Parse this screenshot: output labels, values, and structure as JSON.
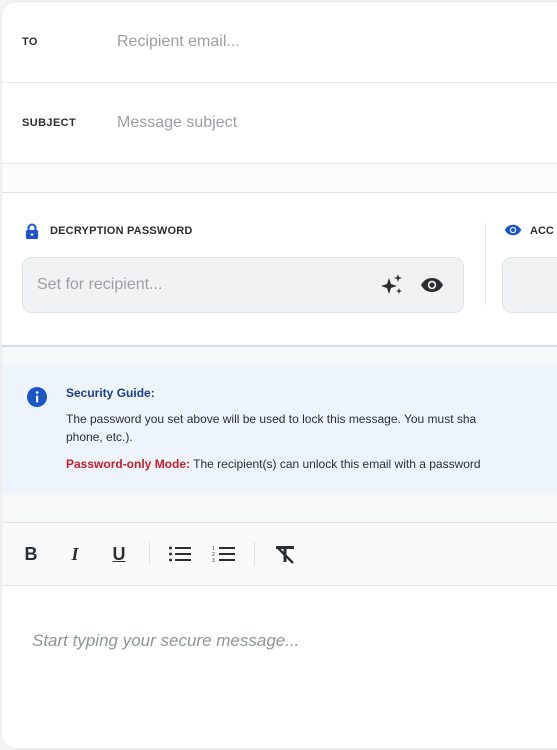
{
  "compose": {
    "to": {
      "label": "TO",
      "placeholder": "Recipient email..."
    },
    "subject": {
      "label": "SUBJECT",
      "placeholder": "Message subject"
    }
  },
  "password": {
    "title": "DECRYPTION PASSWORD",
    "placeholder": "Set for recipient...",
    "generate_icon": "sparkle-icon",
    "toggle_icon": "eye-icon"
  },
  "access": {
    "title_partial": "ACC"
  },
  "guide": {
    "title": "Security Guide:",
    "line1": "The password you set above will be used to lock this message. You must sha",
    "line2": "phone, etc.).",
    "mode_label": "Password-only Mode:",
    "mode_text": " The recipient(s) can unlock this email with a password"
  },
  "toolbar": {
    "bold": "B",
    "italic": "I",
    "underline": "U",
    "bullet_icon": "bullet-list-icon",
    "numbered_icon": "numbered-list-icon",
    "clear_icon": "clear-format-icon"
  },
  "editor": {
    "placeholder": "Start typing your secure message..."
  },
  "colors": {
    "accent": "#1a56c8",
    "guide_title": "#1a3d8f",
    "mode_label": "#c4202b",
    "guide_bg": "#eef4fb"
  }
}
